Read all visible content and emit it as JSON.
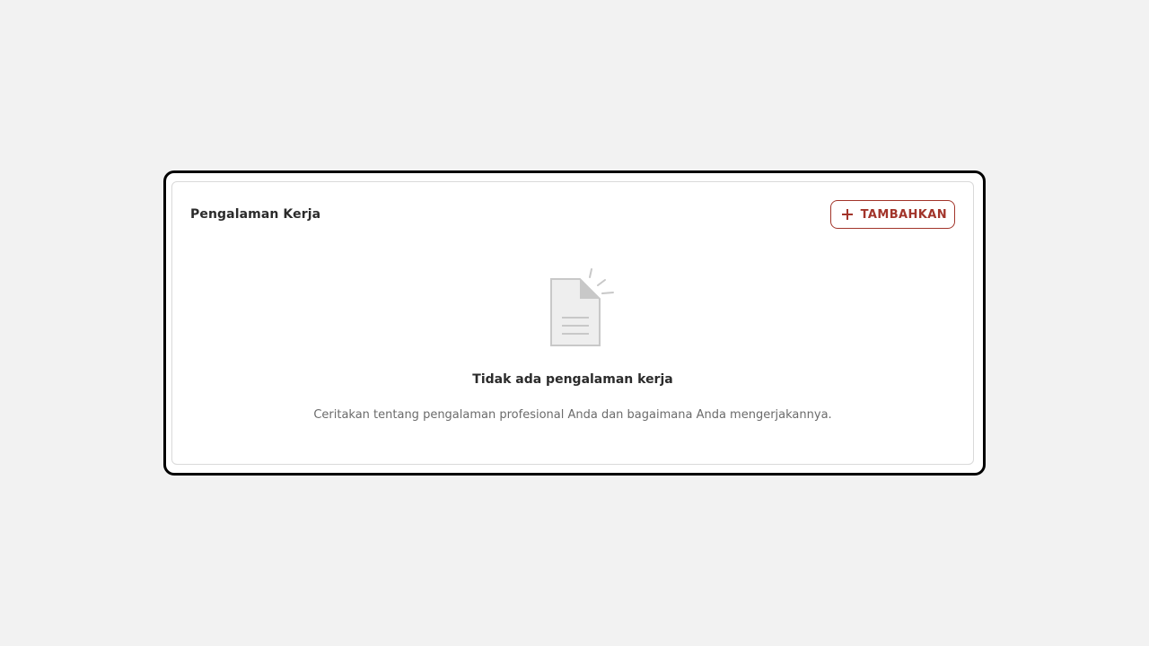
{
  "section": {
    "title": "Pengalaman Kerja",
    "add_button_label": "TAMBAHKAN",
    "add_icon": "plus-icon"
  },
  "empty_state": {
    "icon": "empty-document-icon",
    "title": "Tidak ada pengalaman kerja",
    "description": "Ceritakan tentang pengalaman profesional Anda dan bagaimana Anda mengerjakannya."
  },
  "colors": {
    "accent": "#a2342a",
    "background": "#f2f2f2",
    "card": "#ffffff",
    "frame": "#000000",
    "illustration": "#c8c8c8"
  }
}
